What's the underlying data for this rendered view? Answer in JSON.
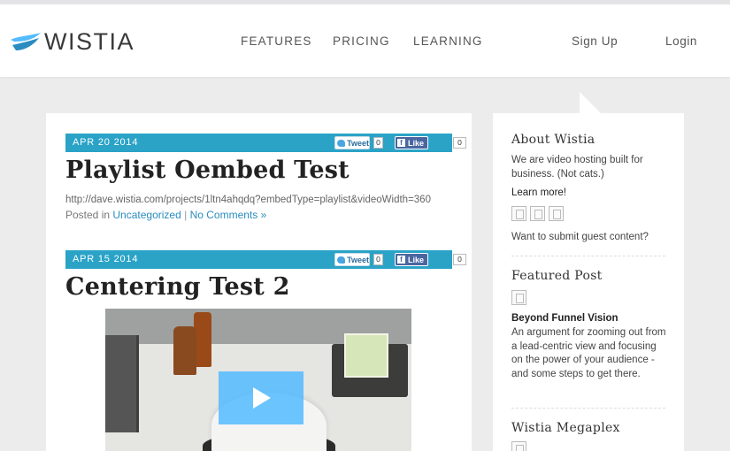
{
  "brand": {
    "name": "WISTIA"
  },
  "nav": {
    "features": "FEATURES",
    "pricing": "PRICING",
    "learning": "LEARNING",
    "signup": "Sign Up",
    "login": "Login"
  },
  "posts": [
    {
      "date": "APR 20 2014",
      "tweet_label": "Tweet",
      "tweet_count": "0",
      "like_label": "Like",
      "like_count": "0",
      "title": "Playlist Oembed Test",
      "url": "http://dave.wistia.com/projects/1ltn4ahqdq?embedType=playlist&videoWidth=360",
      "posted_in": "Posted in",
      "category": "Uncategorized",
      "separator": "|",
      "comments": "No Comments »"
    },
    {
      "date": "APR 15 2014",
      "tweet_label": "Tweet",
      "tweet_count": "0",
      "like_label": "Like",
      "like_count": "0",
      "title": "Centering Test 2"
    }
  ],
  "sidebar": {
    "about_heading": "About Wistia",
    "about_text": "We are video hosting built for business. (Not cats.)",
    "learn_more": "Learn more!",
    "guest": "Want to submit guest content?",
    "featured_heading": "Featured Post",
    "featured_title": "Beyond Funnel Vision",
    "featured_text": "An argument for zooming out from a lead-centric view and focusing on the power of your audience - and some steps to get there.",
    "megaplex_heading": "Wistia Megaplex"
  },
  "colors": {
    "accent": "#2aa3c7",
    "link": "#2a8cc0",
    "facebook": "#4a66a0",
    "play": "#54bbff"
  }
}
